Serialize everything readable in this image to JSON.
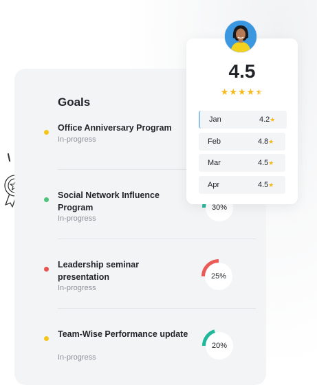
{
  "goals": {
    "title": "Goals",
    "items": [
      {
        "title": "Office Anniversary Program",
        "status": "In-progress",
        "dot_color": "#f5c518"
      },
      {
        "title": "Social Network Influence Program",
        "status": "In-progress",
        "dot_color": "#4cc27a",
        "percent": 30,
        "ring_color": "#2bb6a0",
        "percent_label": "30%"
      },
      {
        "title": "Leadership seminar presentation",
        "status": "In-progress",
        "dot_color": "#e9534f",
        "percent": 25,
        "ring_color": "#ea5a57",
        "percent_label": "25%"
      },
      {
        "title": "Team-Wise Performance update",
        "status": "In-progress",
        "dot_color": "#f5c518",
        "percent": 20,
        "ring_color": "#1fb89a",
        "percent_label": "20%"
      }
    ]
  },
  "rating": {
    "score": "4.5",
    "stars": "★★★★",
    "half_star": "★",
    "months": [
      {
        "month": "Jan",
        "value": "4.2"
      },
      {
        "month": "Feb",
        "value": "4.8"
      },
      {
        "month": "Mar",
        "value": "4.5"
      },
      {
        "month": "Apr",
        "value": "4.5"
      }
    ],
    "star_glyph": "★",
    "star_color": "#f6b81a"
  },
  "icons": {
    "award": "award-ribbon-icon",
    "avatar": "user-avatar"
  }
}
